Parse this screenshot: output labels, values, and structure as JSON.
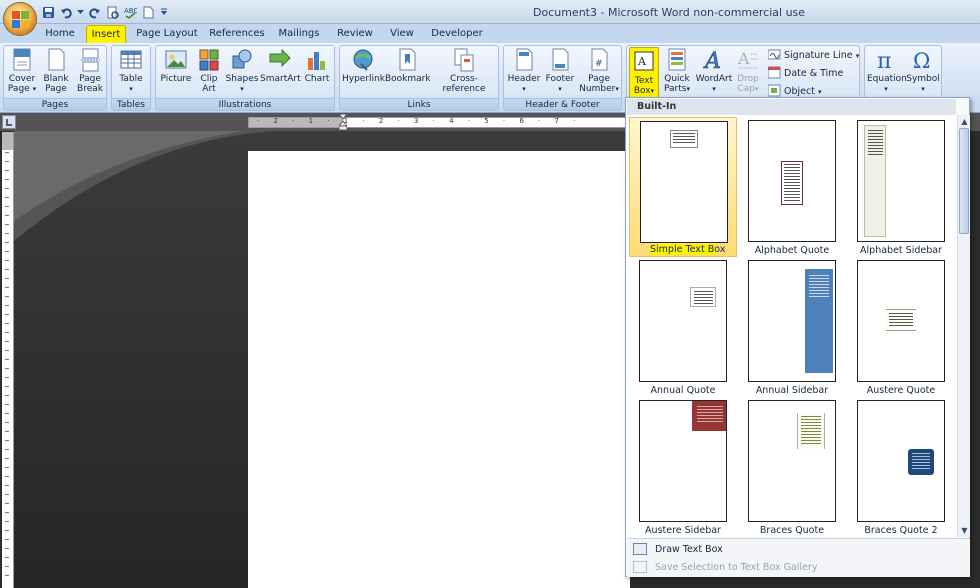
{
  "window": {
    "title": "Document3 - Microsoft Word non-commercial use"
  },
  "tabs": [
    {
      "label": "Home"
    },
    {
      "label": "Insert"
    },
    {
      "label": "Page Layout"
    },
    {
      "label": "References"
    },
    {
      "label": "Mailings"
    },
    {
      "label": "Review"
    },
    {
      "label": "View"
    },
    {
      "label": "Developer"
    }
  ],
  "active_tab": "Insert",
  "ribbon": {
    "groups": {
      "pages": {
        "label": "Pages",
        "buttons": [
          {
            "label": "Cover\nPage",
            "line1": "Cover",
            "line2": "Page"
          },
          {
            "label": "Blank Page",
            "line1": "Blank",
            "line2": "Page"
          },
          {
            "label": "Page Break",
            "line1": "Page",
            "line2": "Break"
          }
        ]
      },
      "tables": {
        "label": "Tables",
        "buttons": [
          {
            "line1": "Table",
            "line2": ""
          }
        ]
      },
      "illustrations": {
        "label": "Illustrations",
        "buttons": [
          {
            "line1": "Picture",
            "line2": ""
          },
          {
            "line1": "Clip",
            "line2": "Art"
          },
          {
            "line1": "Shapes",
            "line2": ""
          },
          {
            "line1": "SmartArt",
            "line2": ""
          },
          {
            "line1": "Chart",
            "line2": ""
          }
        ]
      },
      "links": {
        "label": "Links",
        "buttons": [
          {
            "line1": "Hyperlink",
            "line2": ""
          },
          {
            "line1": "Bookmark",
            "line2": ""
          },
          {
            "line1": "Cross-reference",
            "line2": ""
          }
        ]
      },
      "header_footer": {
        "label": "Header & Footer",
        "buttons": [
          {
            "line1": "Header",
            "line2": ""
          },
          {
            "line1": "Footer",
            "line2": ""
          },
          {
            "line1": "Page",
            "line2": "Number"
          }
        ]
      },
      "text": {
        "buttons": [
          {
            "line1": "Text",
            "line2": "Box"
          },
          {
            "line1": "Quick",
            "line2": "Parts"
          },
          {
            "line1": "WordArt",
            "line2": ""
          },
          {
            "line1": "Drop",
            "line2": "Cap"
          }
        ],
        "small": [
          {
            "label": "Signature Line"
          },
          {
            "label": "Date & Time"
          },
          {
            "label": "Object"
          }
        ]
      },
      "symbols": {
        "buttons": [
          {
            "line1": "Equation",
            "line2": ""
          },
          {
            "line1": "Symbol",
            "line2": ""
          }
        ]
      }
    }
  },
  "gallery": {
    "heading": "Built-In",
    "items": [
      {
        "name": "Simple Text Box",
        "selected": true
      },
      {
        "name": "Alphabet Quote"
      },
      {
        "name": "Alphabet Sidebar"
      },
      {
        "name": "Annual Quote"
      },
      {
        "name": "Annual Sidebar"
      },
      {
        "name": "Austere Quote"
      },
      {
        "name": "Austere Sidebar"
      },
      {
        "name": "Braces Quote"
      },
      {
        "name": "Braces Quote 2"
      }
    ],
    "menu": [
      {
        "label": "Draw Text Box",
        "enabled": true
      },
      {
        "label": "Save Selection to Text Box Gallery",
        "enabled": false
      }
    ]
  },
  "colors": {
    "highlight": "#fff200",
    "ribbon_bg": "#d6e4f5",
    "annual_sidebar_fill": "#4f81bd",
    "austere_sidebar_fill": "#943634",
    "braces_quote2_fill": "#1f497d"
  },
  "ruler": {
    "ticks": "· 2 · 1 · 1 · 2 · 3 · 4 · 5 · 6 · 7 ·"
  },
  "icons": {
    "office_button": "office-logo-icon",
    "qat": [
      "save-icon",
      "undo-icon",
      "redo-icon",
      "print-preview-icon",
      "spelling-icon",
      "new-document-icon",
      "customize-qat-icon"
    ]
  }
}
